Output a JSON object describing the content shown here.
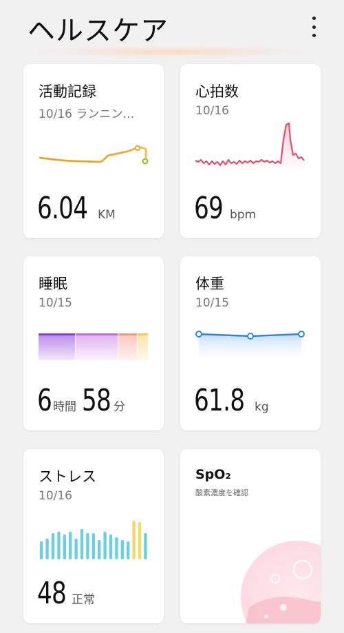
{
  "header": {
    "title": "ヘルスケア",
    "more_icon": "more-vert-icon"
  },
  "cards": {
    "activity": {
      "title": "活動記録",
      "subtitle": "10/16 ランニン…",
      "value": "6.04",
      "unit": "KM",
      "color": "#e8a21a"
    },
    "heart": {
      "title": "心拍数",
      "subtitle": "10/16",
      "value": "69",
      "unit": "bpm",
      "color": "#e0506a"
    },
    "sleep": {
      "title": "睡眠",
      "subtitle": "10/15",
      "hours": "6",
      "hours_unit": "時間",
      "minutes": "58",
      "minutes_unit": "分",
      "colors": [
        "#8a3fd6",
        "#c46be0",
        "#f09a8a",
        "#f5c85a"
      ]
    },
    "weight": {
      "title": "体重",
      "subtitle": "10/15",
      "value": "61.8",
      "unit": "kg",
      "color": "#2a86e0"
    },
    "stress": {
      "title": "ストレス",
      "subtitle": "10/16",
      "value": "48",
      "status": "正常",
      "bar_color": "#6ad0e0",
      "high_color": "#f5d76a"
    },
    "spo2": {
      "title": "SpO₂",
      "subtitle": "酸素濃度を確認"
    }
  }
}
